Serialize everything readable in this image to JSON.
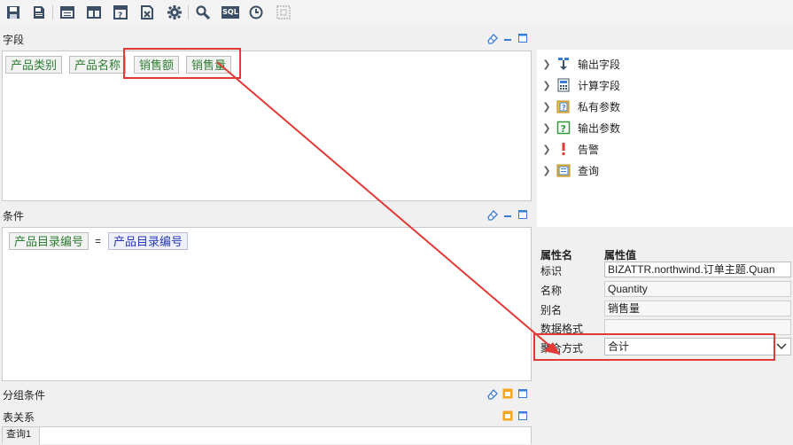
{
  "toolbar": {
    "icons": [
      "save-icon",
      "save-as-icon",
      "table-layout-icon",
      "columns-layout-icon",
      "param-form-icon",
      "export-icon",
      "settings-gear-icon",
      "search-icon",
      "sql-icon",
      "clock-icon",
      "disabled-grid-icon"
    ],
    "sql_label": "SQL"
  },
  "fields": {
    "title": "字段",
    "chips": [
      "产品类别",
      "产品名称",
      "销售额",
      "销售量"
    ]
  },
  "conditions": {
    "title": "条件",
    "left": "产品目录编号",
    "operator": "=",
    "right": "产品目录编号"
  },
  "group_conditions": {
    "title": "分组条件"
  },
  "table_relations": {
    "title": "表关系",
    "tab": "查询1"
  },
  "tree": {
    "items": [
      {
        "label": "输出字段",
        "icon": "output-field-icon"
      },
      {
        "label": "计算字段",
        "icon": "calculator-icon"
      },
      {
        "label": "私有参数",
        "icon": "private-param-icon"
      },
      {
        "label": "输出参数",
        "icon": "output-param-icon"
      },
      {
        "label": "告警",
        "icon": "alert-icon"
      },
      {
        "label": "查询",
        "icon": "query-icon"
      }
    ]
  },
  "properties": {
    "header_name": "属性名",
    "header_value": "属性值",
    "rows": [
      {
        "name": "标识",
        "value": "BIZATTR.northwind.订单主题.Quan"
      },
      {
        "name": "名称",
        "value": "Quantity"
      },
      {
        "name": "别名",
        "value": "销售量"
      },
      {
        "name": "数据格式",
        "value": ""
      },
      {
        "name": "聚合方式",
        "value": "合计"
      }
    ]
  },
  "colors": {
    "highlight": "#e53935",
    "field_text": "#2e7d32",
    "condition_value_text": "#2838b0"
  }
}
